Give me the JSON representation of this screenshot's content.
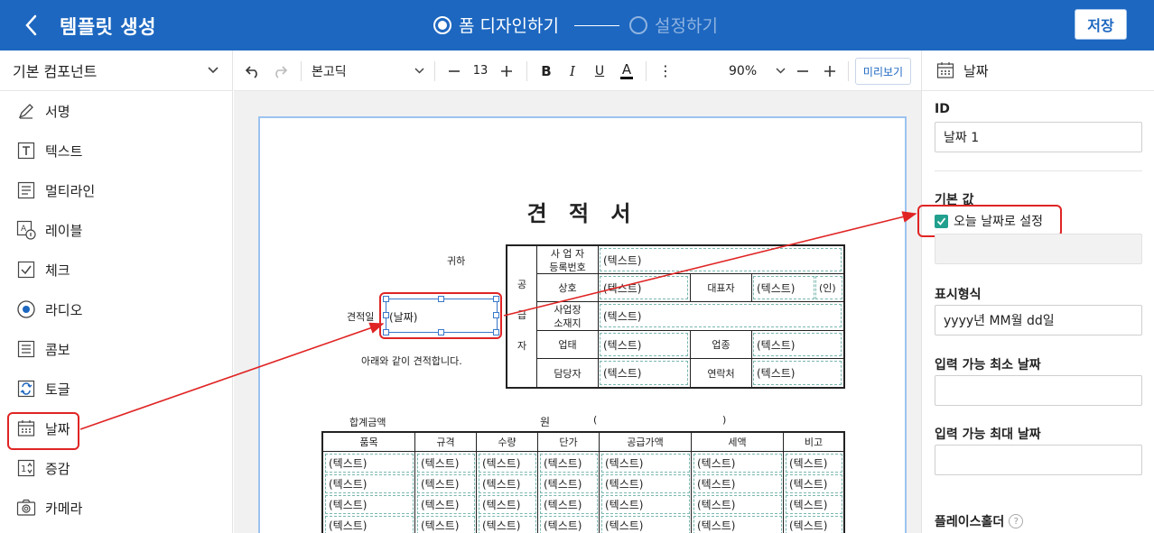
{
  "header": {
    "title": "템플릿 생성",
    "step1": "폼 디자인하기",
    "step2": "설정하기",
    "save": "저장"
  },
  "sidebar": {
    "category": "기본 컴포넌트",
    "items": [
      {
        "label": "서명",
        "icon": "pen-icon"
      },
      {
        "label": "텍스트",
        "icon": "text-icon"
      },
      {
        "label": "멀티라인",
        "icon": "multiline-icon"
      },
      {
        "label": "레이블",
        "icon": "label-icon"
      },
      {
        "label": "체크",
        "icon": "checkbox-icon"
      },
      {
        "label": "라디오",
        "icon": "radio-icon"
      },
      {
        "label": "콤보",
        "icon": "combo-icon"
      },
      {
        "label": "토글",
        "icon": "toggle-icon"
      },
      {
        "label": "날짜",
        "icon": "calendar-icon"
      },
      {
        "label": "증감",
        "icon": "stepper-icon"
      },
      {
        "label": "카메라",
        "icon": "camera-icon"
      }
    ]
  },
  "toolbar": {
    "font": "본고딕",
    "font_size": "13",
    "zoom": "90%",
    "preview": "미리보기"
  },
  "document": {
    "title": "견 적 서",
    "recipient_suffix": "귀하",
    "quote_date_label": "견적일",
    "date_field_value": "(날짜)",
    "statement": "아래와 같이 견적합니다.",
    "supplier_label": [
      "공",
      "급",
      "자"
    ],
    "supplier_rows": [
      {
        "label1": "사 업 자",
        "label2": "등록번호",
        "value": "(텍스트)"
      },
      {
        "label": "상호",
        "value": "(텍스트)",
        "label_b": "대표자",
        "value_b": "(텍스트)",
        "seal": "(인)"
      },
      {
        "label1": "사업장",
        "label2": "소재지",
        "value": "(텍스트)"
      },
      {
        "label": "업태",
        "value": "(텍스트)",
        "label_b": "업종",
        "value_b": "(텍스트)"
      },
      {
        "label": "담당자",
        "value": "(텍스트)",
        "label_b": "연락처",
        "value_b": "(텍스트)"
      }
    ],
    "total_label": "합계금액",
    "won": "원",
    "paren_open": "(",
    "paren_close": ")",
    "item_headers": [
      "품목",
      "규격",
      "수량",
      "단가",
      "공급가액",
      "세액",
      "비고"
    ],
    "item_rows": [
      [
        "(텍스트)",
        "(텍스트)",
        "(텍스트)",
        "(텍스트)",
        "(텍스트)",
        "(텍스트)",
        "(텍스트)"
      ],
      [
        "(텍스트)",
        "(텍스트)",
        "(텍스트)",
        "(텍스트)",
        "(텍스트)",
        "(텍스트)",
        "(텍스트)"
      ],
      [
        "(텍스트)",
        "(텍스트)",
        "(텍스트)",
        "(텍스트)",
        "(텍스트)",
        "(텍스트)",
        "(텍스트)"
      ],
      [
        "(텍스트)",
        "(텍스트)",
        "(텍스트)",
        "(텍스트)",
        "(텍스트)",
        "(텍스트)",
        "(텍스트)"
      ]
    ]
  },
  "props": {
    "component": "날짜",
    "id_label": "ID",
    "id_value": "날짜 1",
    "default_label": "기본 값",
    "today_checkbox": "오늘 날짜로 설정",
    "today_checked": true,
    "format_label": "표시형식",
    "format_value": "yyyy년 MM월 dd일",
    "min_label": "입력 가능 최소 날짜",
    "max_label": "입력 가능 최대 날짜",
    "placeholder_label": "플레이스홀더",
    "help": "?"
  },
  "colors": {
    "header_bg": "#1d67c0",
    "highlight": "#e02424",
    "check": "#21a08e"
  }
}
